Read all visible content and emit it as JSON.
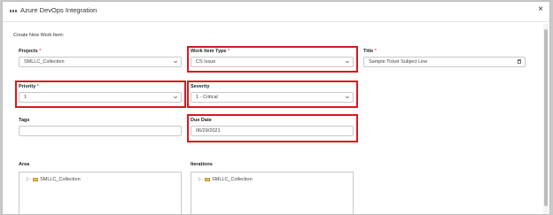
{
  "dialog": {
    "title": "Azure DevOps Integration",
    "close_glyph": "×",
    "subtitle": "Create New Work Item:"
  },
  "required_marker": "*",
  "fields": {
    "projects": {
      "label": "Projects",
      "value": "SMLLC_Collection"
    },
    "work_item_type": {
      "label": "Work Item Type",
      "value": "CS Issue"
    },
    "title": {
      "label": "Title",
      "value": "Sample Ticket Subject Line"
    },
    "priority": {
      "label": "Priority",
      "value": "1"
    },
    "severity": {
      "label": "Severity",
      "value": "1 - Critical"
    },
    "tags": {
      "label": "Tags",
      "value": ""
    },
    "due_date": {
      "label": "Due Date",
      "value": "06/29/2021"
    },
    "area": {
      "label": "Area",
      "root": "SMLLC_Collection"
    },
    "iterations": {
      "label": "Iterations",
      "root": "SMLLC_Collection"
    }
  },
  "highlight_color": "#d7191f"
}
